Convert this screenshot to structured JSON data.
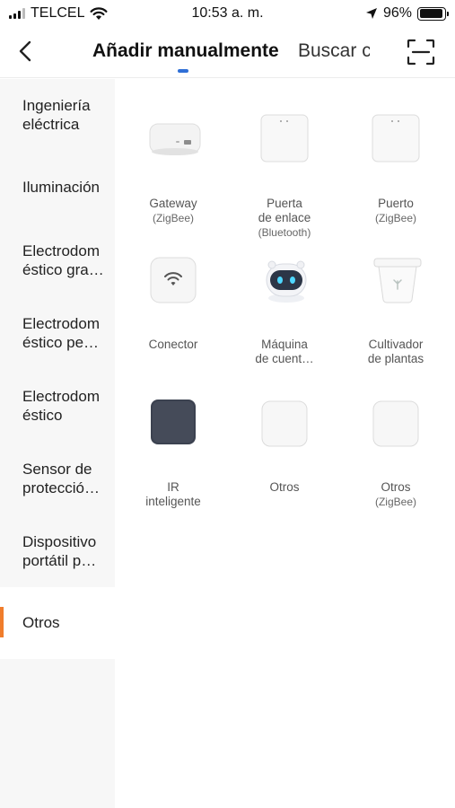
{
  "status_bar": {
    "carrier": "TELCEL",
    "time": "10:53 a. m.",
    "battery": "96%",
    "battery_level": 0.96
  },
  "header": {
    "tab_active": "Añadir manualmente",
    "tab_inactive": "Buscar c",
    "accent_color": "#2f6fd6"
  },
  "sidebar": {
    "active_color": "#f07d2c",
    "items": [
      {
        "label": "Ingeniería\neléctrica"
      },
      {
        "label": "Iluminación"
      },
      {
        "label": "Electrodom\néstico gra…"
      },
      {
        "label": "Electrodom\néstico pe…"
      },
      {
        "label": "Electrodom\néstico"
      },
      {
        "label": "Sensor de\nprotecció…"
      },
      {
        "label": "Dispositivo\nportátil p…"
      },
      {
        "label": "Otros"
      }
    ]
  },
  "devices": [
    {
      "name": "Gateway",
      "sub": "(ZigBee)",
      "icon": "gateway-hub-icon"
    },
    {
      "name": "Puerta\nde enlace",
      "sub": "(Bluetooth)",
      "icon": "bluetooth-gateway-icon"
    },
    {
      "name": "Puerto",
      "sub": "(ZigBee)",
      "icon": "zigbee-port-icon"
    },
    {
      "name": "Conector",
      "sub": "",
      "icon": "wifi-connector-icon"
    },
    {
      "name": "Máquina\nde cuent…",
      "sub": "",
      "icon": "robot-icon"
    },
    {
      "name": "Cultivador\nde plantas",
      "sub": "",
      "icon": "plant-pot-icon"
    },
    {
      "name": "IR\ninteligente",
      "sub": "",
      "icon": "ir-remote-icon"
    },
    {
      "name": "Otros",
      "sub": "",
      "icon": "other-device-icon"
    },
    {
      "name": "Otros",
      "sub": "(ZigBee)",
      "icon": "other-zigbee-device-icon"
    }
  ]
}
